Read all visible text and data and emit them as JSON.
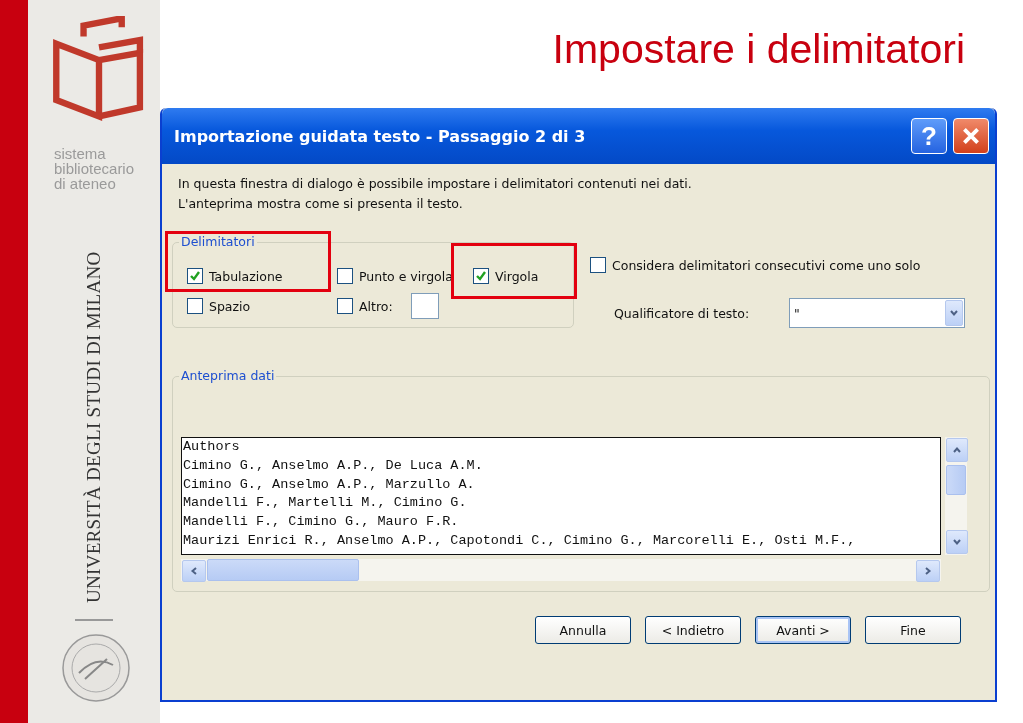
{
  "sidebar": {
    "library_name": [
      "sistema",
      "bibliotecario",
      "di ateneo"
    ],
    "university": "UNIVERSITÀ DEGLI STUDI DI MILANO"
  },
  "slide_title": "Impostare i delimitatori",
  "dialog": {
    "title": "Importazione guidata testo - Passaggio 2 di 3",
    "help_button": "?",
    "intro": [
      "In questa finestra di dialogo è possibile impostare i delimitatori contenuti nei dati.",
      "L'anteprima mostra come si presenta il testo."
    ],
    "delimiters": {
      "legend": "Delimitatori",
      "options": [
        {
          "label": "Tabulazione",
          "checked": true,
          "highlighted": true
        },
        {
          "label": "Punto e virgola",
          "checked": false,
          "highlighted": false
        },
        {
          "label": "Virgola",
          "checked": true,
          "highlighted": true
        },
        {
          "label": "Spazio",
          "checked": false,
          "highlighted": false
        },
        {
          "label": "Altro:",
          "checked": false,
          "highlighted": false
        }
      ]
    },
    "consecutive": {
      "label": "Considera delimitatori consecutivi come uno solo",
      "checked": false
    },
    "qualifier": {
      "label": "Qualificatore di testo:",
      "value": "\""
    },
    "preview": {
      "legend": "Anteprima dati",
      "lines": [
        "Authors",
        "Cimino G., Anselmo A.P., De Luca A.M.",
        "Cimino G., Anselmo A.P., Marzullo A.",
        "Mandelli F., Martelli M., Cimino G.",
        "Mandelli F., Cimino G., Mauro F.R.",
        "Maurizi Enrici R., Anselmo A.P., Capotondi C., Cimino G., Marcorelli E., Osti M.F.,"
      ]
    },
    "buttons": [
      {
        "label": "Annulla",
        "default": false
      },
      {
        "label": "< Indietro",
        "default": false
      },
      {
        "label": "Avanti >",
        "default": true
      },
      {
        "label": "Fine",
        "default": false
      }
    ]
  }
}
